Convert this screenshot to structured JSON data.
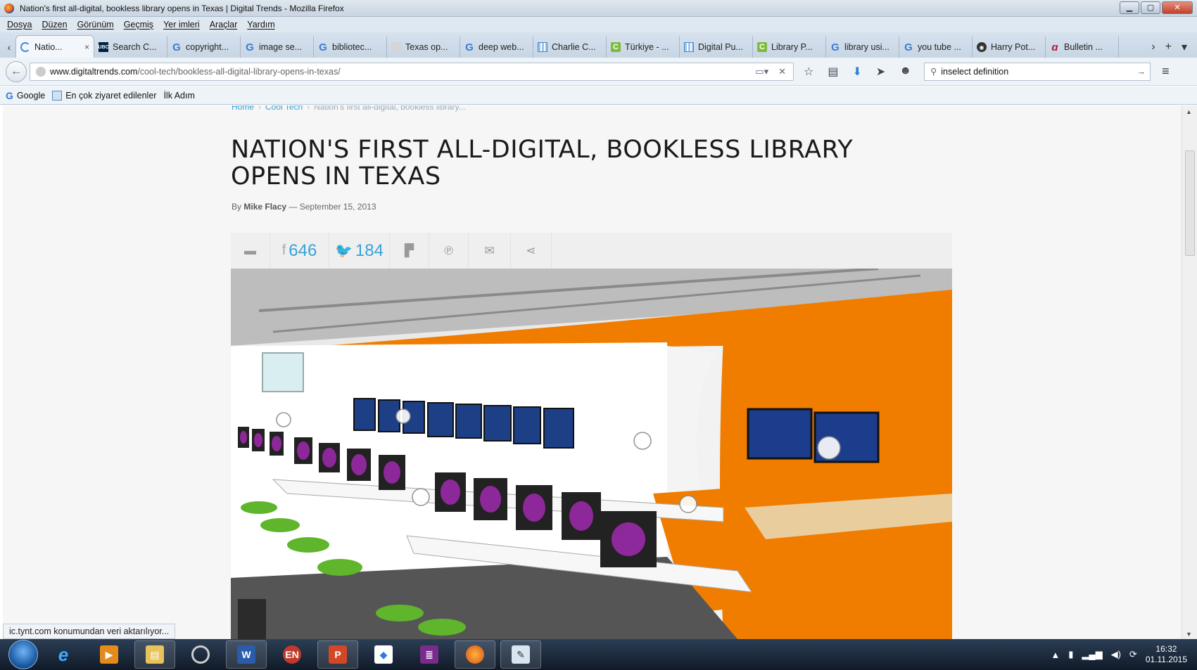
{
  "window": {
    "title": "Nation's first all-digital, bookless library opens in Texas | Digital Trends - Mozilla Firefox",
    "minimize": "▁",
    "maximize": "▢",
    "close": "✕"
  },
  "menu": [
    "Dosya",
    "Düzen",
    "Görünüm",
    "Geçmiş",
    "Yer imleri",
    "Araçlar",
    "Yardım"
  ],
  "tabs": [
    {
      "label": "Natio...",
      "favicon": "loading-icon",
      "active": true
    },
    {
      "label": "Search C...",
      "favicon": "ubc-icon"
    },
    {
      "label": "copyright...",
      "favicon": "google-icon"
    },
    {
      "label": "image se...",
      "favicon": "google-icon"
    },
    {
      "label": "bibliotec...",
      "favicon": "google-icon"
    },
    {
      "label": "Texas op...",
      "favicon": "image-icon"
    },
    {
      "label": "deep web...",
      "favicon": "google-icon"
    },
    {
      "label": "Charlie C...",
      "favicon": "grid-icon"
    },
    {
      "label": "Türkiye - ...",
      "favicon": "c-icon"
    },
    {
      "label": "Digital Pu...",
      "favicon": "grid-icon"
    },
    {
      "label": "Library P...",
      "favicon": "c-icon"
    },
    {
      "label": "library usi...",
      "favicon": "google-icon"
    },
    {
      "label": "you tube ...",
      "favicon": "google-icon"
    },
    {
      "label": "Harry Pot...",
      "favicon": "hp-icon"
    },
    {
      "label": "Bulletin ...",
      "favicon": "ebsco-icon"
    }
  ],
  "tab_close": "×",
  "nav": {
    "url_host": "www.digitaltrends.com",
    "url_path": "/cool-tech/bookless-all-digital-library-opens-in-texas/",
    "search_value": "inselect definition"
  },
  "bookmarks": {
    "google": "Google",
    "most_visited": "En çok ziyaret edilenler",
    "first_step": "İlk Adım"
  },
  "article": {
    "breadcrumb_home": "Home",
    "breadcrumb_section": "Cool Tech",
    "breadcrumb_current": "Nation's first all-digital, bookless library...",
    "title": "NATION'S FIRST ALL-DIGITAL, BOOKLESS LIBRARY OPENS IN TEXAS",
    "by": "By",
    "author": "Mike Flacy",
    "dash": "—",
    "date": "September 15, 2013",
    "facebook_count": "646",
    "twitter_count": "184"
  },
  "status": "ic.tynt.com konumundan veri aktarılıyor...",
  "clock": {
    "time": "16:32",
    "date": "01.11.2015"
  },
  "colors": {
    "accent": "#35a3d8",
    "orange": "#f07d00"
  }
}
